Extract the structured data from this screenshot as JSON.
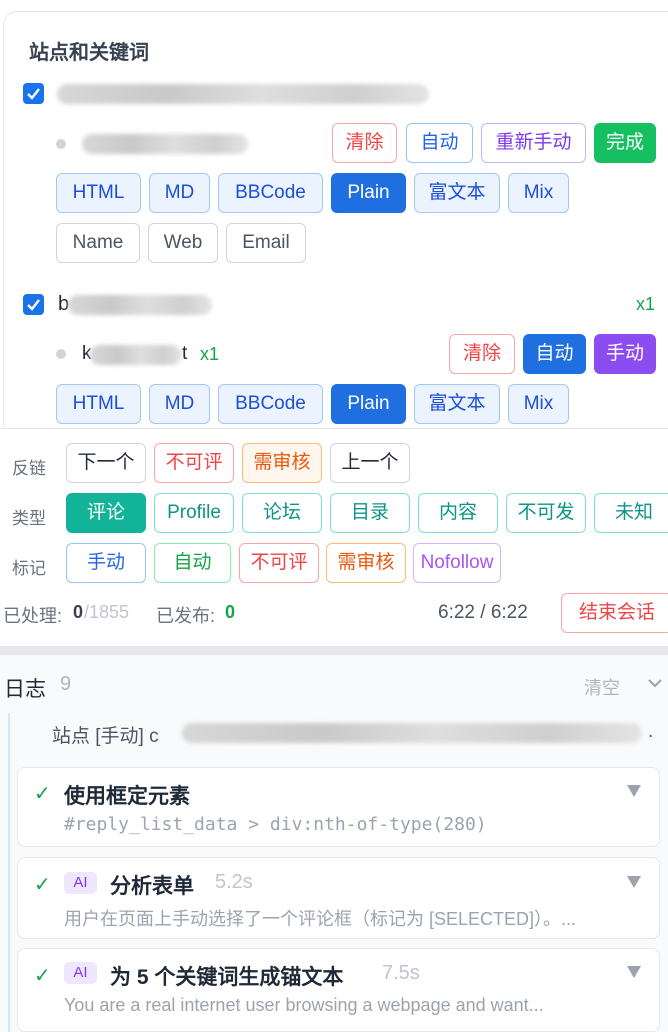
{
  "sites_keywords": {
    "title": "站点和关键词",
    "site1": {
      "keyword_actions": {
        "clear": "清除",
        "auto": "自动",
        "remanual": "重新手动",
        "done": "完成"
      },
      "formats": [
        "HTML",
        "MD",
        "BBCode",
        "Plain",
        "富文本",
        "Mix"
      ],
      "fields": [
        "Name",
        "Web",
        "Email"
      ]
    },
    "site2": {
      "name_prefix": "b",
      "count": "x1",
      "keyword_prefix": "k",
      "keyword_suffix": "t",
      "keyword_count": "x1",
      "keyword_actions": {
        "clear": "清除",
        "auto": "自动",
        "manual": "手动"
      },
      "formats": [
        "HTML",
        "MD",
        "BBCode",
        "Plain",
        "富文本",
        "Mix"
      ]
    }
  },
  "backlink_row": {
    "label": "反链",
    "buttons": [
      "下一个",
      "不可评",
      "需审核",
      "上一个"
    ]
  },
  "type_row": {
    "label": "类型",
    "buttons": [
      "评论",
      "Profile",
      "论坛",
      "目录",
      "内容",
      "不可发",
      "未知"
    ]
  },
  "mark_row": {
    "label": "标记",
    "buttons": [
      "手动",
      "自动",
      "不可评",
      "需审核",
      "Nofollow"
    ]
  },
  "status": {
    "processed_label": "已处理:",
    "processed": "0",
    "total": "/1855",
    "published_label": "已发布:",
    "published": "0",
    "time": "6:22 / 6:22",
    "end_button": "结束会话"
  },
  "log": {
    "title": "日志",
    "count": "9",
    "clear": "清空",
    "site_line_prefix": "站点 [手动] c",
    "site_line_suffix": ".",
    "entries": [
      {
        "title": "使用框定元素",
        "ai": false,
        "time": "",
        "detail": "#reply_list_data > div:nth-of-type(280)"
      },
      {
        "title": "分析表单",
        "ai": true,
        "ai_label": "AI",
        "time": "5.2s",
        "detail": "用户在页面上手动选择了一个评论框（标记为 [SELECTED]）。..."
      },
      {
        "title": "为 5 个关键词生成锚文本",
        "ai": true,
        "ai_label": "AI",
        "time": "7.5s",
        "detail": "You are a real internet user browsing a webpage and want..."
      }
    ]
  }
}
